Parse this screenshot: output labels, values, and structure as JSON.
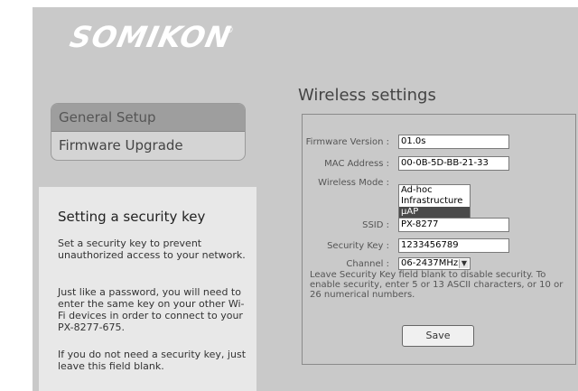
{
  "brand": {
    "logo": "SOMIKON",
    "reg": "®"
  },
  "menu": {
    "items": [
      {
        "label": "General Setup"
      },
      {
        "label": "Firmware Upgrade"
      }
    ]
  },
  "help": {
    "title": "Setting a security key",
    "p1": "Set a security key to prevent unauthorized access to your network.",
    "p2": "Just like a password, you will need to enter the same key on your other Wi-Fi devices in order to connect to your PX-8277-675.",
    "p3": "If you do not need a security key, just leave this field blank."
  },
  "page": {
    "title": "Wireless settings"
  },
  "form": {
    "firmware_label": "Firmware Version :",
    "firmware_value": "01.0s",
    "mac_label": "MAC Address :",
    "mac_value": "00-0B-5D-BB-21-33",
    "mode_label": "Wireless Mode :",
    "mode_options": [
      "Ad-hoc",
      "Infrastructure",
      "µAP"
    ],
    "mode_selected": "µAP",
    "ssid_label": "SSID :",
    "ssid_value": "PX-8277",
    "key_label": "Security Key :",
    "key_value": "1233456789",
    "channel_label": "Channel :",
    "channel_value": "06-2437MHz",
    "note": "Leave Security Key field blank to disable security. To enable security, enter 5 or 13 ASCII characters, or 10 or 26 numerical numbers.",
    "save_label": "Save"
  },
  "colors": {
    "panel": "#c9c9c9",
    "help_bg": "#e8e8e8",
    "active_menu": "#9e9e9e",
    "selected_option": "#4a4a4a"
  }
}
